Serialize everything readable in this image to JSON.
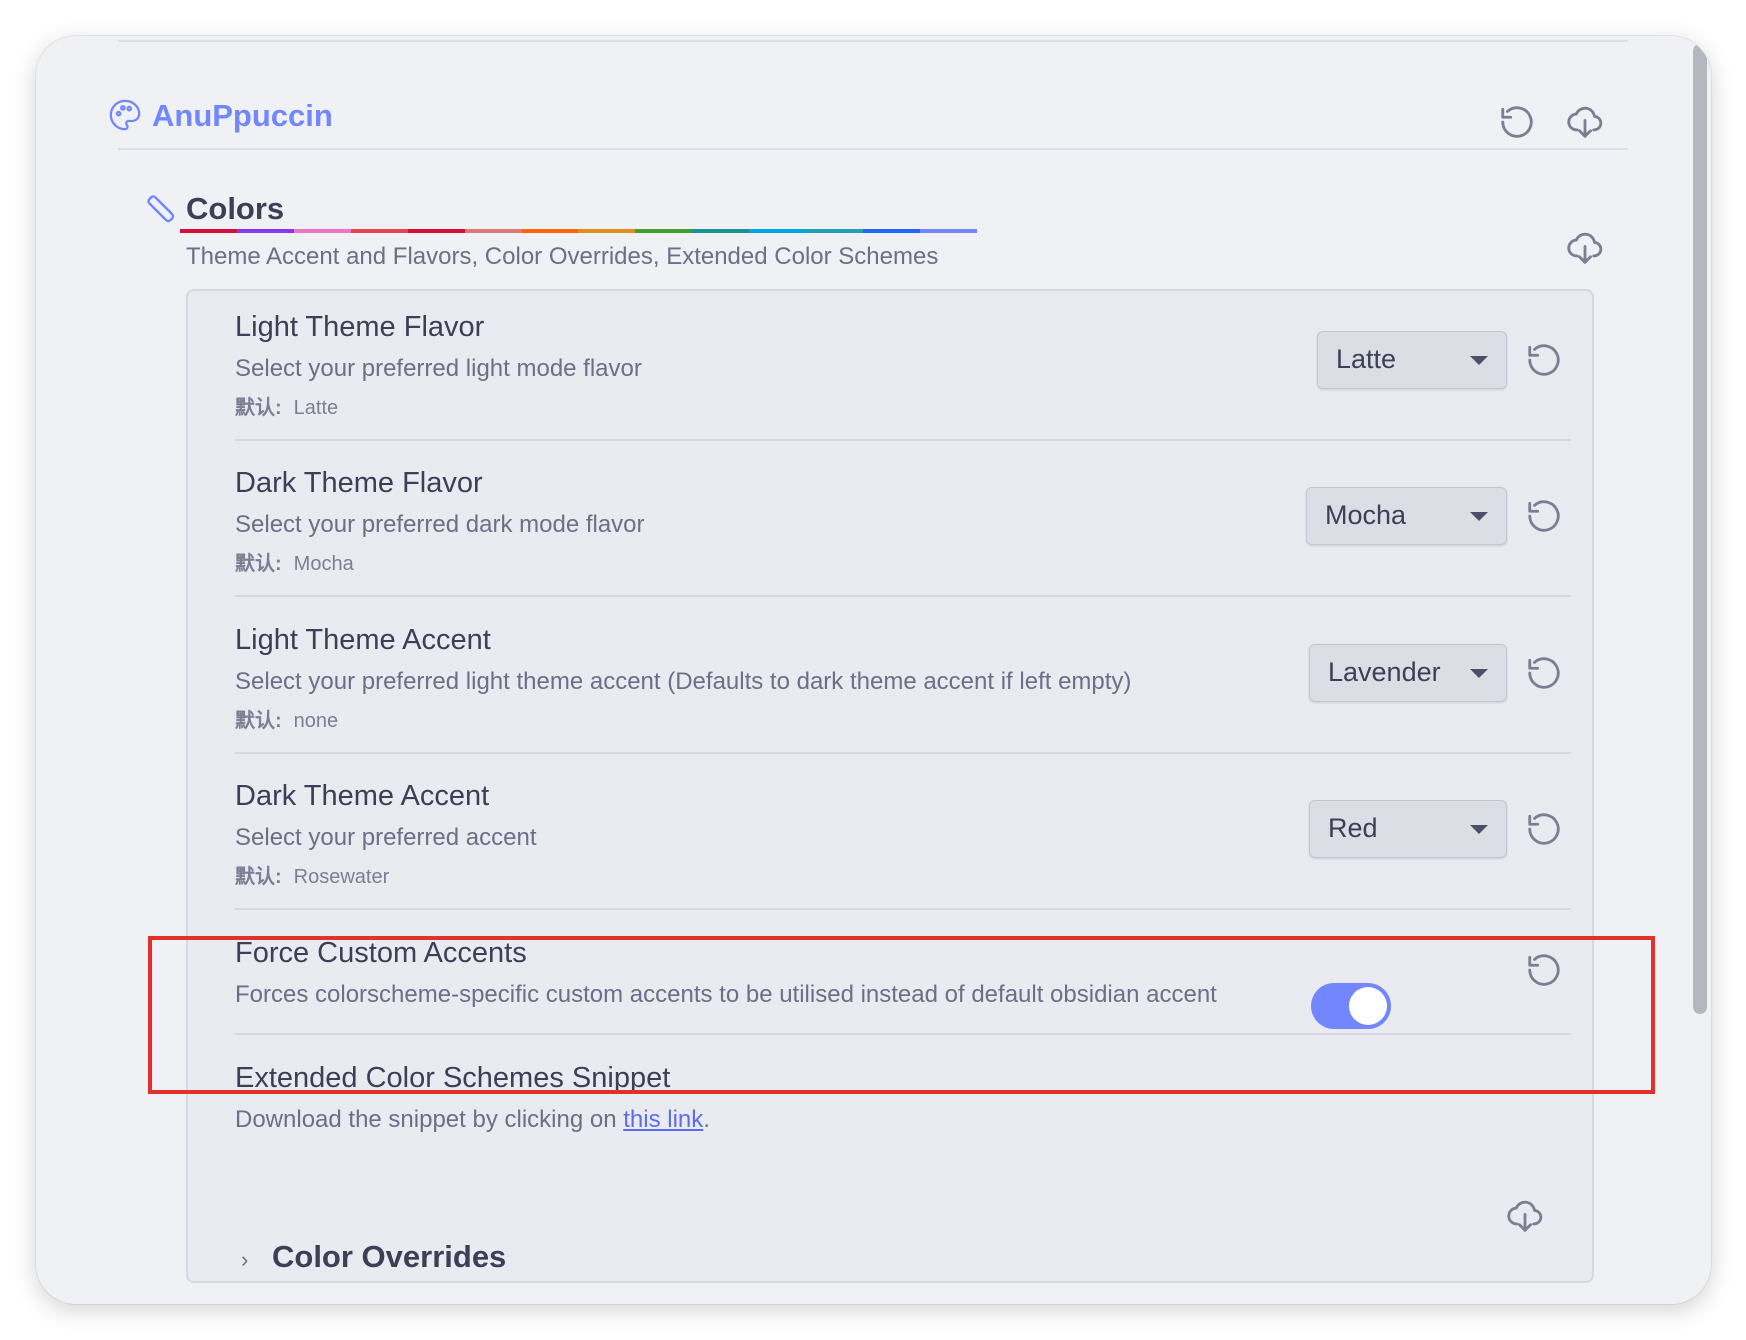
{
  "plugin": {
    "title": "AnuPpuccin"
  },
  "section": {
    "title": "Colors",
    "description": "Theme Accent and Flavors, Color Overrides, Extended Color Schemes"
  },
  "default_key": "默认:",
  "settings": [
    {
      "name": "Light Theme Flavor",
      "desc": "Select your preferred light mode flavor",
      "default": "Latte",
      "value": "Latte"
    },
    {
      "name": "Dark Theme Flavor",
      "desc": "Select your preferred dark mode flavor",
      "default": "Mocha",
      "value": "Mocha"
    },
    {
      "name": "Light Theme Accent",
      "desc": "Select your preferred light theme accent (Defaults to dark theme accent if left empty)",
      "default": "none",
      "value": "Lavender"
    },
    {
      "name": "Dark Theme Accent",
      "desc": "Select your preferred accent",
      "default": "Rosewater",
      "value": "Red"
    },
    {
      "name": "Force Custom Accents",
      "desc": "Forces colorscheme-specific custom accents to be utilised instead of default obsidian accent",
      "toggle_on": true
    }
  ],
  "extended": {
    "name": "Extended Color Schemes Snippet",
    "desc_prefix": "Download the snippet by clicking on ",
    "link_text": "this link",
    "desc_suffix": "."
  },
  "overrides": {
    "title": "Color Overrides"
  },
  "colors": {
    "accent": "#7287fd",
    "highlight": "#e2312a",
    "rainbow": [
      "#d20f39",
      "#8839ef",
      "#ea76cb",
      "#e64553",
      "#d20f39",
      "#dd7878",
      "#fe640b",
      "#df8e1d",
      "#40a02b",
      "#179299",
      "#04a5e5",
      "#209fb5",
      "#1e66f5",
      "#7287fd"
    ]
  }
}
